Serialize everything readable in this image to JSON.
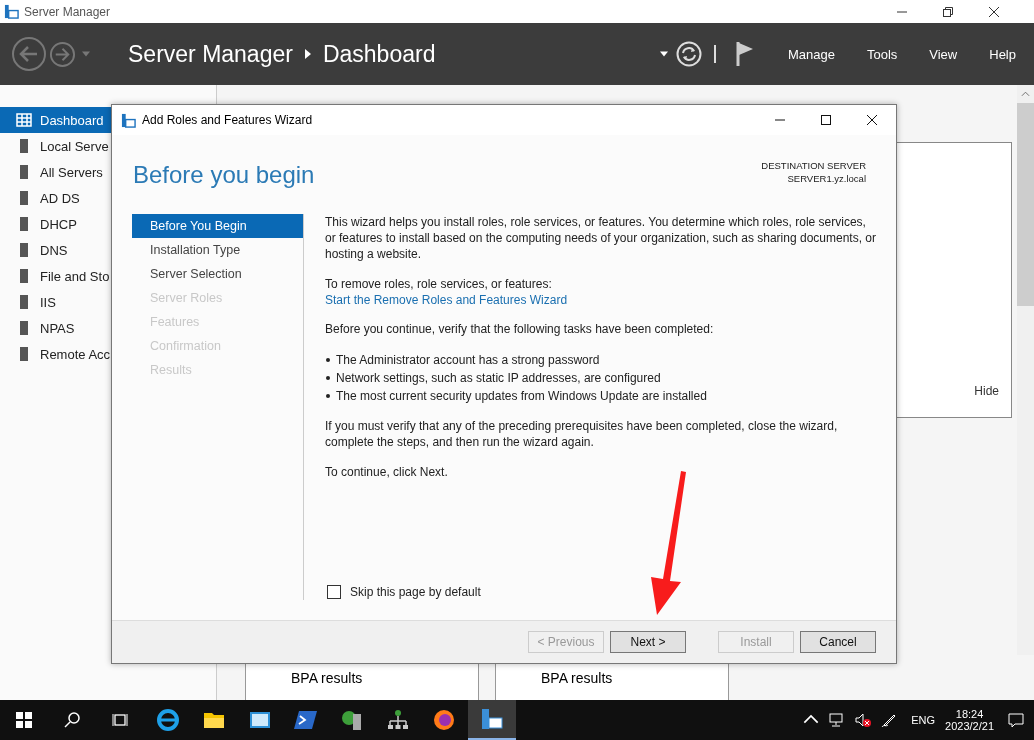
{
  "app": {
    "title": "Server Manager",
    "breadcrumb": [
      "Server Manager",
      "Dashboard"
    ],
    "menu": [
      "Manage",
      "Tools",
      "View",
      "Help"
    ]
  },
  "sidebar": {
    "items": [
      {
        "label": "Dashboard",
        "selected": true
      },
      {
        "label": "Local Serve",
        "selected": false
      },
      {
        "label": "All Servers",
        "selected": false
      },
      {
        "label": "AD DS",
        "selected": false
      },
      {
        "label": "DHCP",
        "selected": false
      },
      {
        "label": "DNS",
        "selected": false
      },
      {
        "label": "File and Sto",
        "selected": false
      },
      {
        "label": "IIS",
        "selected": false
      },
      {
        "label": "NPAS",
        "selected": false
      },
      {
        "label": "Remote Acc",
        "selected": false
      }
    ]
  },
  "main": {
    "hide_link": "Hide",
    "tiles": [
      "BPA results",
      "BPA results"
    ]
  },
  "wizard": {
    "title": "Add Roles and Features Wizard",
    "heading": "Before you begin",
    "destination_label": "DESTINATION SERVER",
    "destination_server": "SERVER1.yz.local",
    "steps": [
      {
        "label": "Before You Begin",
        "selected": true,
        "disabled": false
      },
      {
        "label": "Installation Type",
        "selected": false,
        "disabled": false
      },
      {
        "label": "Server Selection",
        "selected": false,
        "disabled": false
      },
      {
        "label": "Server Roles",
        "selected": false,
        "disabled": true
      },
      {
        "label": "Features",
        "selected": false,
        "disabled": true
      },
      {
        "label": "Confirmation",
        "selected": false,
        "disabled": true
      },
      {
        "label": "Results",
        "selected": false,
        "disabled": true
      }
    ],
    "blocks": [
      {
        "kind": "text",
        "text": "This wizard helps you install roles, role services, or features. You determine which roles, role services, or features to install based on the computing needs of your organization, such as sharing documents, or hosting a website."
      },
      {
        "kind": "label",
        "text": "To remove roles, role services, or features:"
      },
      {
        "kind": "link",
        "text": "Start the Remove Roles and Features Wizard"
      },
      {
        "kind": "text",
        "text": "Before you continue, verify that the following tasks have been completed:"
      },
      {
        "kind": "bullets",
        "items": [
          "The Administrator account has a strong password",
          "Network settings, such as static IP addresses, are configured",
          "The most current security updates from Windows Update are installed"
        ]
      },
      {
        "kind": "text",
        "text": "If you must verify that any of the preceding prerequisites have been completed, close the wizard, complete the steps, and then run the wizard again."
      },
      {
        "kind": "text",
        "text": "To continue, click Next."
      }
    ],
    "skip": {
      "label": "Skip this page by default",
      "checked": false
    },
    "buttons": [
      {
        "label": "< Previous",
        "disabled": true
      },
      {
        "label": "Next >",
        "disabled": false
      },
      {
        "label": "Install",
        "disabled": true
      },
      {
        "label": "Cancel",
        "disabled": false
      }
    ]
  },
  "taskbar": {
    "language": "ENG",
    "time": "18:24",
    "date": "2023/2/21"
  }
}
